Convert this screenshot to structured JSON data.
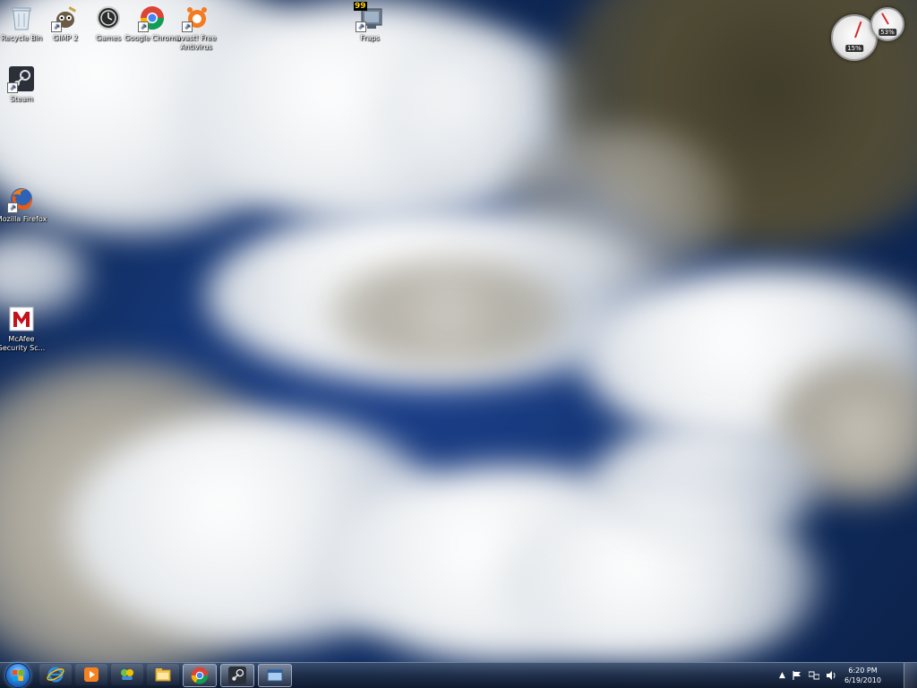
{
  "desktop": {
    "icons": [
      {
        "label": "Recycle Bin",
        "icon": "recycle-bin-icon"
      },
      {
        "label": "GIMP 2",
        "icon": "gimp-icon"
      },
      {
        "label": "Games",
        "icon": "games-icon"
      },
      {
        "label": "Google Chrome",
        "icon": "chrome-icon"
      },
      {
        "label": "avast! Free Antivirus",
        "icon": "avast-icon"
      },
      {
        "label": "Fraps",
        "icon": "fraps-icon",
        "badge": "99"
      },
      {
        "label": "Steam",
        "icon": "steam-icon"
      },
      {
        "label": "Mozilla Firefox",
        "icon": "firefox-icon"
      },
      {
        "label": "McAfee Security Sc...",
        "icon": "mcafee-icon"
      }
    ]
  },
  "gadget": {
    "cpu_percent": "15%",
    "memory_percent": "53%"
  },
  "taskbar": {
    "pinned": [
      {
        "icon": "internet-explorer-icon"
      },
      {
        "icon": "media-player-icon"
      },
      {
        "icon": "messenger-icon"
      },
      {
        "icon": "file-explorer-icon"
      },
      {
        "icon": "chrome-icon"
      },
      {
        "icon": "steam-icon"
      },
      {
        "icon": "window-icon"
      }
    ],
    "clock": {
      "time": "6:20 PM",
      "date": "6/19/2010"
    }
  },
  "colors": {
    "sky_blue": "#153675",
    "taskbar": "#1e2d46",
    "start_orb": "#2a7dd9"
  }
}
